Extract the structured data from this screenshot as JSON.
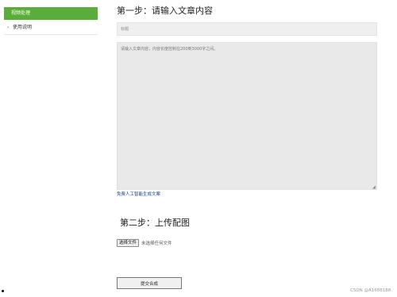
{
  "sidebar": {
    "active_item": "视频处理",
    "items": [
      {
        "label": "使用说明",
        "icon": "chevron-right-icon"
      }
    ]
  },
  "step1": {
    "heading": "第一步：请输入文章内容",
    "title_placeholder": "标题",
    "content_placeholder": "请输入文章内容，内容长度控制在200到3000字之间。",
    "ai_link": "免费人工智能生成文案"
  },
  "step2": {
    "heading": "第二步：上传配图",
    "file_button": "选择文件",
    "file_status": "未选择任何文件"
  },
  "submit_label": "提交合成",
  "watermark": "CSDN @A1688188.",
  "colors": {
    "accent": "#5aad3a",
    "link": "#1a3e8c"
  }
}
